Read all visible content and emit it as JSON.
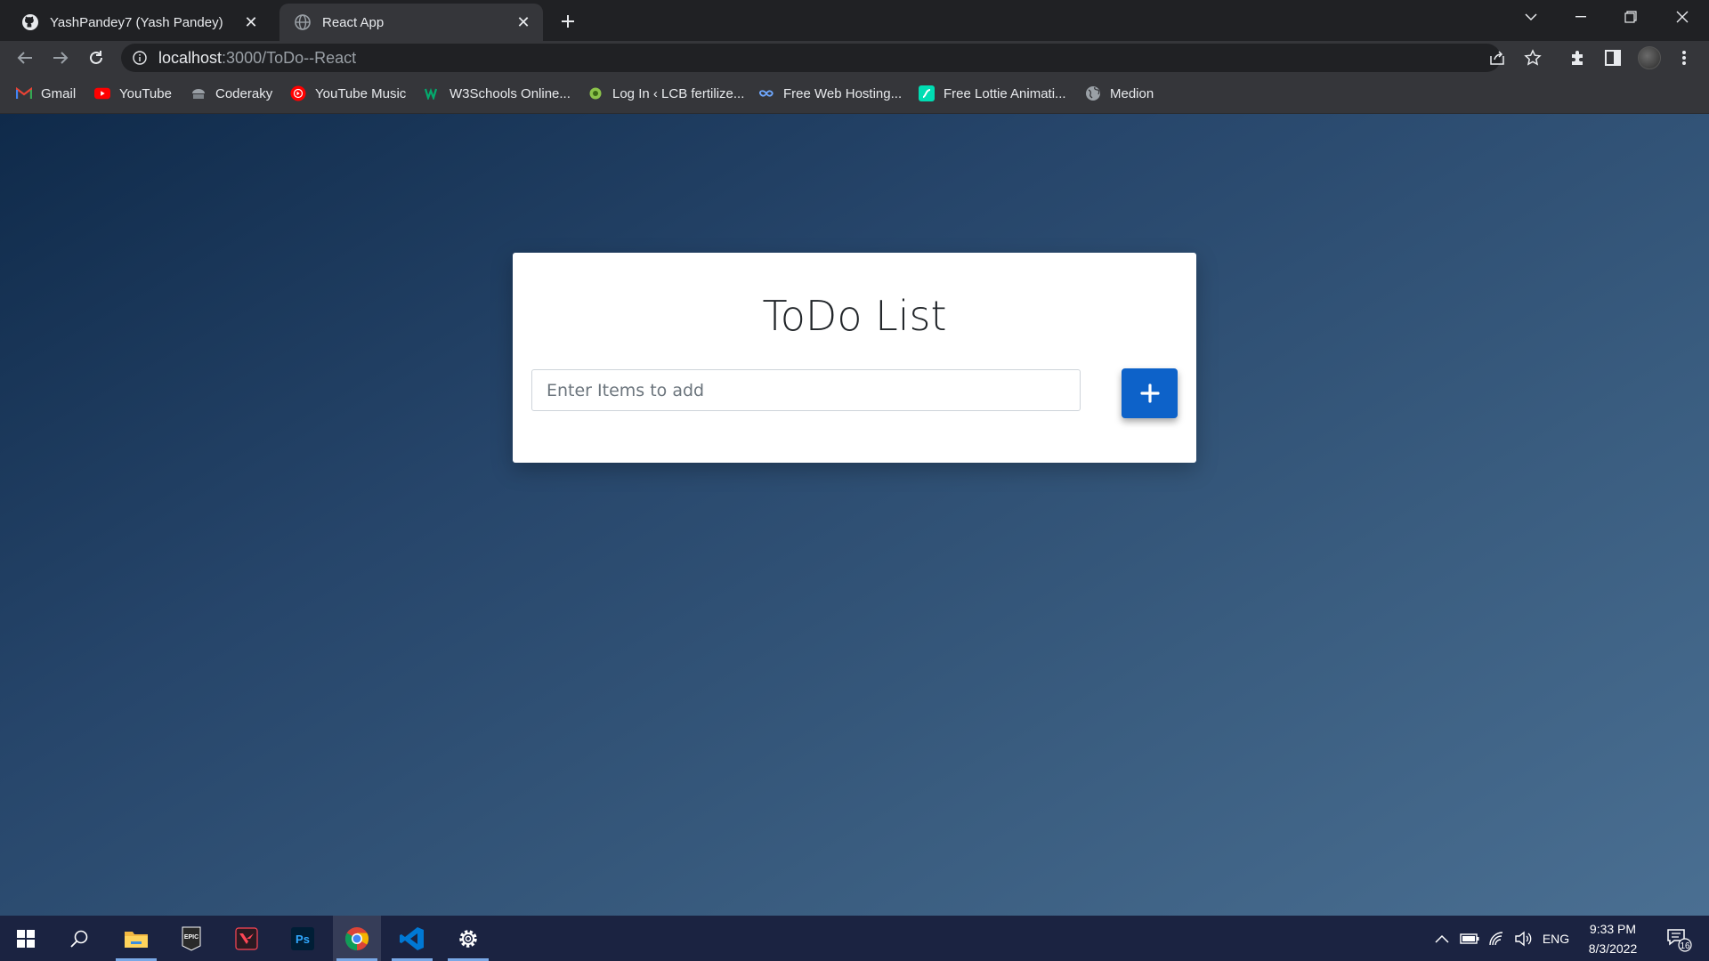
{
  "browser": {
    "tabs": [
      {
        "title": "YashPandey7 (Yash Pandey)",
        "favicon": "github-icon",
        "active": false
      },
      {
        "title": "React App",
        "favicon": "globe-icon",
        "active": true
      }
    ],
    "url_host": "localhost",
    "url_rest": ":3000/ToDo--React",
    "bookmarks": [
      {
        "label": "Gmail",
        "icon": "gmail-icon",
        "color": "#ea4335"
      },
      {
        "label": "YouTube",
        "icon": "youtube-icon",
        "color": "#ff0000"
      },
      {
        "label": "Coderaky",
        "icon": "coderaky-icon",
        "color": "#9aa0a6"
      },
      {
        "label": "YouTube Music",
        "icon": "youtube-music-icon",
        "color": "#ff0000"
      },
      {
        "label": "W3Schools Online...",
        "icon": "w3schools-icon",
        "color": "#04aa6d"
      },
      {
        "label": "Log In ‹ LCB fertilize...",
        "icon": "lcb-icon",
        "color": "#8bc34a"
      },
      {
        "label": "Free Web Hosting...",
        "icon": "infinity-icon",
        "color": "#6fa8ff"
      },
      {
        "label": "Free Lottie Animati...",
        "icon": "lottie-icon",
        "color": "#00ddb3"
      },
      {
        "label": "Medion",
        "icon": "globe-icon",
        "color": "#9aa0a6"
      }
    ]
  },
  "app": {
    "title": "ToDo List",
    "input_placeholder": "Enter Items to add",
    "input_value": "",
    "add_button_icon": "plus-icon",
    "button_color": "#0d62c9"
  },
  "taskbar": {
    "apps": [
      "windows-start-icon",
      "search-icon",
      "file-explorer-icon",
      "epic-games-icon",
      "valorant-icon",
      "photoshop-icon",
      "chrome-icon",
      "vscode-icon",
      "settings-icon"
    ],
    "epic_label": "EPIC",
    "ps_label": "Ps",
    "language": "ENG",
    "time": "9:33 PM",
    "date": "8/3/2022",
    "notifications": "16"
  }
}
